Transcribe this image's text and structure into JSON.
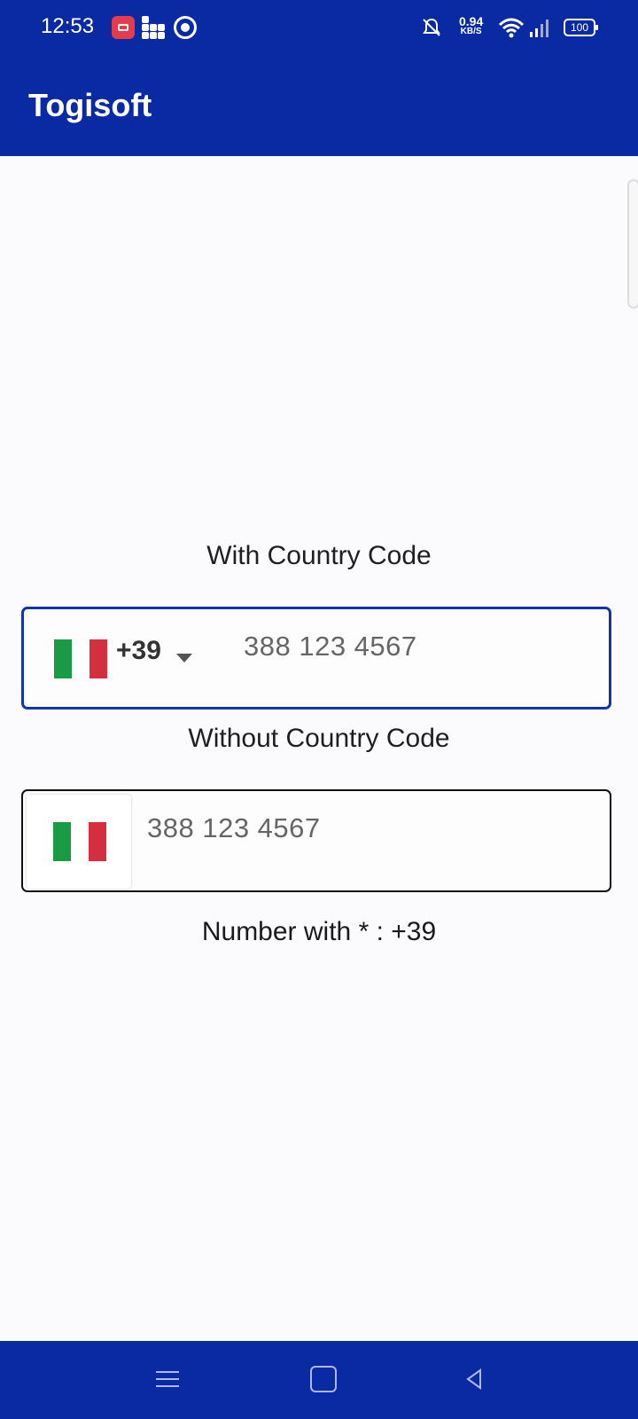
{
  "status_bar": {
    "time": "12:53",
    "net_speed_value": "0.94",
    "net_speed_unit": "KB/S",
    "battery": "100",
    "icons": [
      "screen-record-icon",
      "grid-app-icon",
      "circle-app-icon",
      "mute-icon",
      "wifi-icon",
      "signal-icon",
      "battery-icon"
    ]
  },
  "app_bar": {
    "title": "Togisoft"
  },
  "section_with_code": {
    "label": "With Country Code",
    "country_code": "+39",
    "placeholder": "388 123 4567"
  },
  "section_without_code": {
    "label": "Without Country Code",
    "placeholder": "388 123 4567"
  },
  "result": {
    "text": "Number with * : +39"
  },
  "nav_bar": {
    "icons": [
      "menu-icon",
      "home-icon",
      "back-icon"
    ]
  },
  "colors": {
    "primary": "#0a2aa3",
    "focused_border": "#1236a6",
    "flag_green": "#1b9a46",
    "flag_red": "#d32f3f"
  }
}
